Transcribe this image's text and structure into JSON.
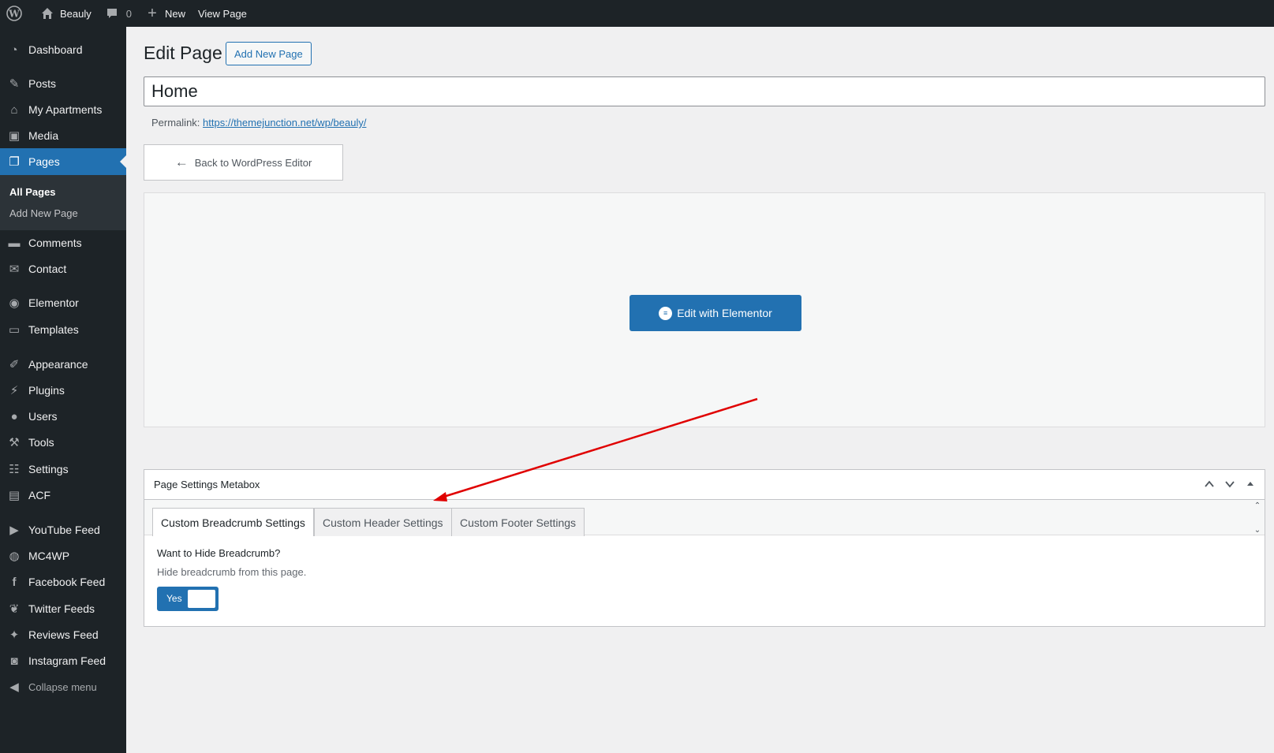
{
  "admin_bar": {
    "wp_logo_icon": "wordpress-icon",
    "site_name": "Beauly",
    "comments_count": "0",
    "new_label": "New",
    "view_page_label": "View Page"
  },
  "sidebar": {
    "items": [
      {
        "label": "Dashboard",
        "icon": "dashboard-icon"
      },
      {
        "label": "Posts",
        "icon": "pin-icon"
      },
      {
        "label": "My Apartments",
        "icon": "apartments-icon"
      },
      {
        "label": "Media",
        "icon": "media-icon"
      },
      {
        "label": "Pages",
        "icon": "pages-icon"
      },
      {
        "label": "Comments",
        "icon": "comment-icon"
      },
      {
        "label": "Contact",
        "icon": "mail-icon"
      },
      {
        "label": "Elementor",
        "icon": "elementor-icon"
      },
      {
        "label": "Templates",
        "icon": "folder-icon"
      },
      {
        "label": "Appearance",
        "icon": "brush-icon"
      },
      {
        "label": "Plugins",
        "icon": "plugin-icon"
      },
      {
        "label": "Users",
        "icon": "user-icon"
      },
      {
        "label": "Tools",
        "icon": "wrench-icon"
      },
      {
        "label": "Settings",
        "icon": "sliders-icon"
      },
      {
        "label": "ACF",
        "icon": "table-icon"
      },
      {
        "label": "YouTube Feed",
        "icon": "youtube-icon"
      },
      {
        "label": "MC4WP",
        "icon": "mc4wp-icon"
      },
      {
        "label": "Facebook Feed",
        "icon": "facebook-icon"
      },
      {
        "label": "Twitter Feeds",
        "icon": "twitter-icon"
      },
      {
        "label": "Reviews Feed",
        "icon": "reviews-icon"
      },
      {
        "label": "Instagram Feed",
        "icon": "camera-icon"
      }
    ],
    "submenu": {
      "all_pages": "All Pages",
      "add_new_page": "Add New Page"
    },
    "collapse_label": "Collapse menu"
  },
  "main": {
    "page_title": "Edit Page",
    "add_new_button": "Add New Page",
    "title_value": "Home",
    "permalink_label": "Permalink:",
    "permalink_url": "https://themejunction.net/wp/beauly/",
    "back_button": "Back to WordPress Editor",
    "elementor_button": "Edit with Elementor"
  },
  "metabox": {
    "title": "Page Settings Metabox",
    "tabs": [
      "Custom Breadcrumb Settings",
      "Custom Header Settings",
      "Custom Footer Settings"
    ],
    "field_label": "Want to Hide Breadcrumb?",
    "field_description": "Hide breadcrumb from this page.",
    "toggle_value": "Yes"
  },
  "colors": {
    "accent": "#2271b1",
    "admin_dark": "#1d2327",
    "annotation_arrow": "#e00000"
  }
}
